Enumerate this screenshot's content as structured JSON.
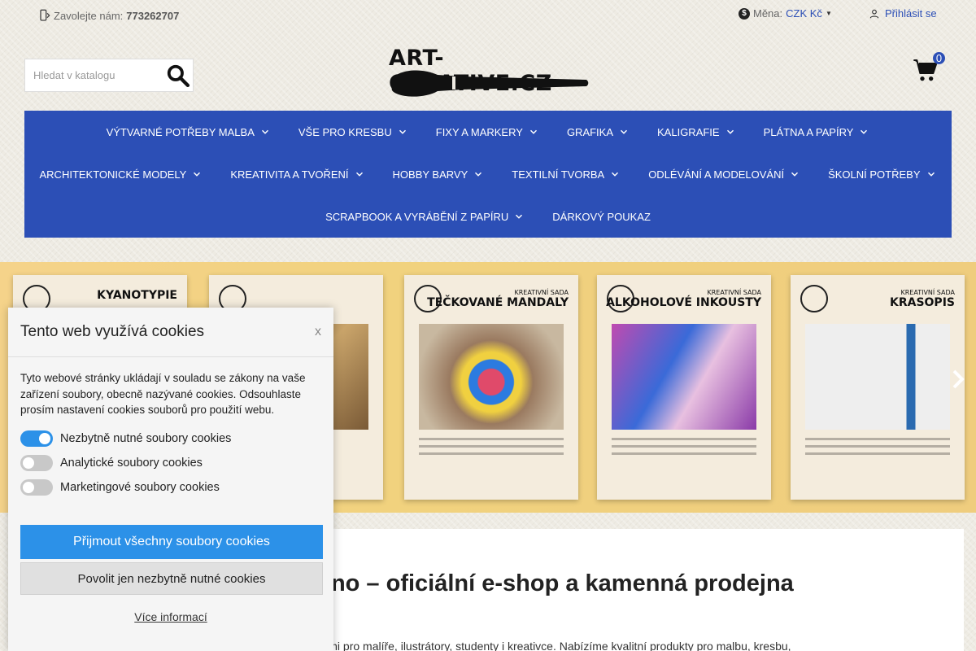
{
  "topbar": {
    "phone_label": "Zavolejte nám:",
    "phone_number": "773262707",
    "currency_label": "Měna:",
    "currency_value": "CZK Kč",
    "login_label": "Přihlásit se"
  },
  "header": {
    "search_placeholder": "Hledat v katalogu",
    "logo_text": "ART-CREATIVE.CZ",
    "cart_count": "0"
  },
  "nav": {
    "row1": [
      {
        "label": "Výtvarné potřeby malba",
        "dropdown": true
      },
      {
        "label": "Vše pro kresbu",
        "dropdown": true
      },
      {
        "label": "Fixy a markery",
        "dropdown": true
      },
      {
        "label": "Grafika",
        "dropdown": true
      },
      {
        "label": "Kaligrafie",
        "dropdown": true
      },
      {
        "label": "Plátna a papíry",
        "dropdown": true
      }
    ],
    "row2": [
      {
        "label": "Architektonické modely",
        "dropdown": true
      },
      {
        "label": "Kreativita a tvoření",
        "dropdown": true
      },
      {
        "label": "Hobby barvy",
        "dropdown": true
      },
      {
        "label": "Textilní tvorba",
        "dropdown": true
      },
      {
        "label": "Odlévání a modelování",
        "dropdown": true
      },
      {
        "label": "Školní potřeby",
        "dropdown": true
      }
    ],
    "row3": [
      {
        "label": "Scrapbook a vyrábění z papíru",
        "dropdown": true
      },
      {
        "label": "Dárkový poukaz",
        "dropdown": false
      }
    ]
  },
  "banner": {
    "cards": [
      {
        "subtitle": "",
        "title": "KYANOTYPIE"
      },
      {
        "subtitle": "",
        "title": ""
      },
      {
        "subtitle": "KREATIVNÍ SADA",
        "title": "TEČKOVANÉ MANDALY"
      },
      {
        "subtitle": "KREATIVNÍ SADA",
        "title": "ALKOHOLOVÉ INKOUSTY"
      },
      {
        "subtitle": "KREATIVNÍ SADA",
        "title": "KRASOPIS"
      }
    ]
  },
  "content": {
    "heading": "Art Creative Brno – oficiální e-shop a kamenná prodejna",
    "heading_visible": "rt Creative Brno – oficiální e-shop a kamenná prodejna",
    "intro": "Jsme specializovaný obchod s výtvarnými potřebami pro malíře, ilustrátory, studenty i kreativce. Nabízíme kvalitní produkty pro malbu, kresbu,"
  },
  "cookie": {
    "title": "Tento web využívá cookies",
    "close": "x",
    "text": "Tyto webové stránky ukládají v souladu se zákony na vaše zařízení soubory, obecně nazývané cookies. Odsouhlaste prosím nastavení cookies souborů pro použití webu.",
    "toggles": [
      {
        "label": "Nezbytně nutné soubory cookies",
        "on": true
      },
      {
        "label": "Analytické soubory cookies",
        "on": false
      },
      {
        "label": "Marketingové soubory cookies",
        "on": false
      }
    ],
    "accept_all": "Přijmout všechny soubory cookies",
    "accept_necessary": "Povolit jen nezbytně nutné cookies",
    "more": "Více informací"
  },
  "colors": {
    "primary": "#2c4fb6",
    "cookie_blue": "#2c91e8"
  }
}
